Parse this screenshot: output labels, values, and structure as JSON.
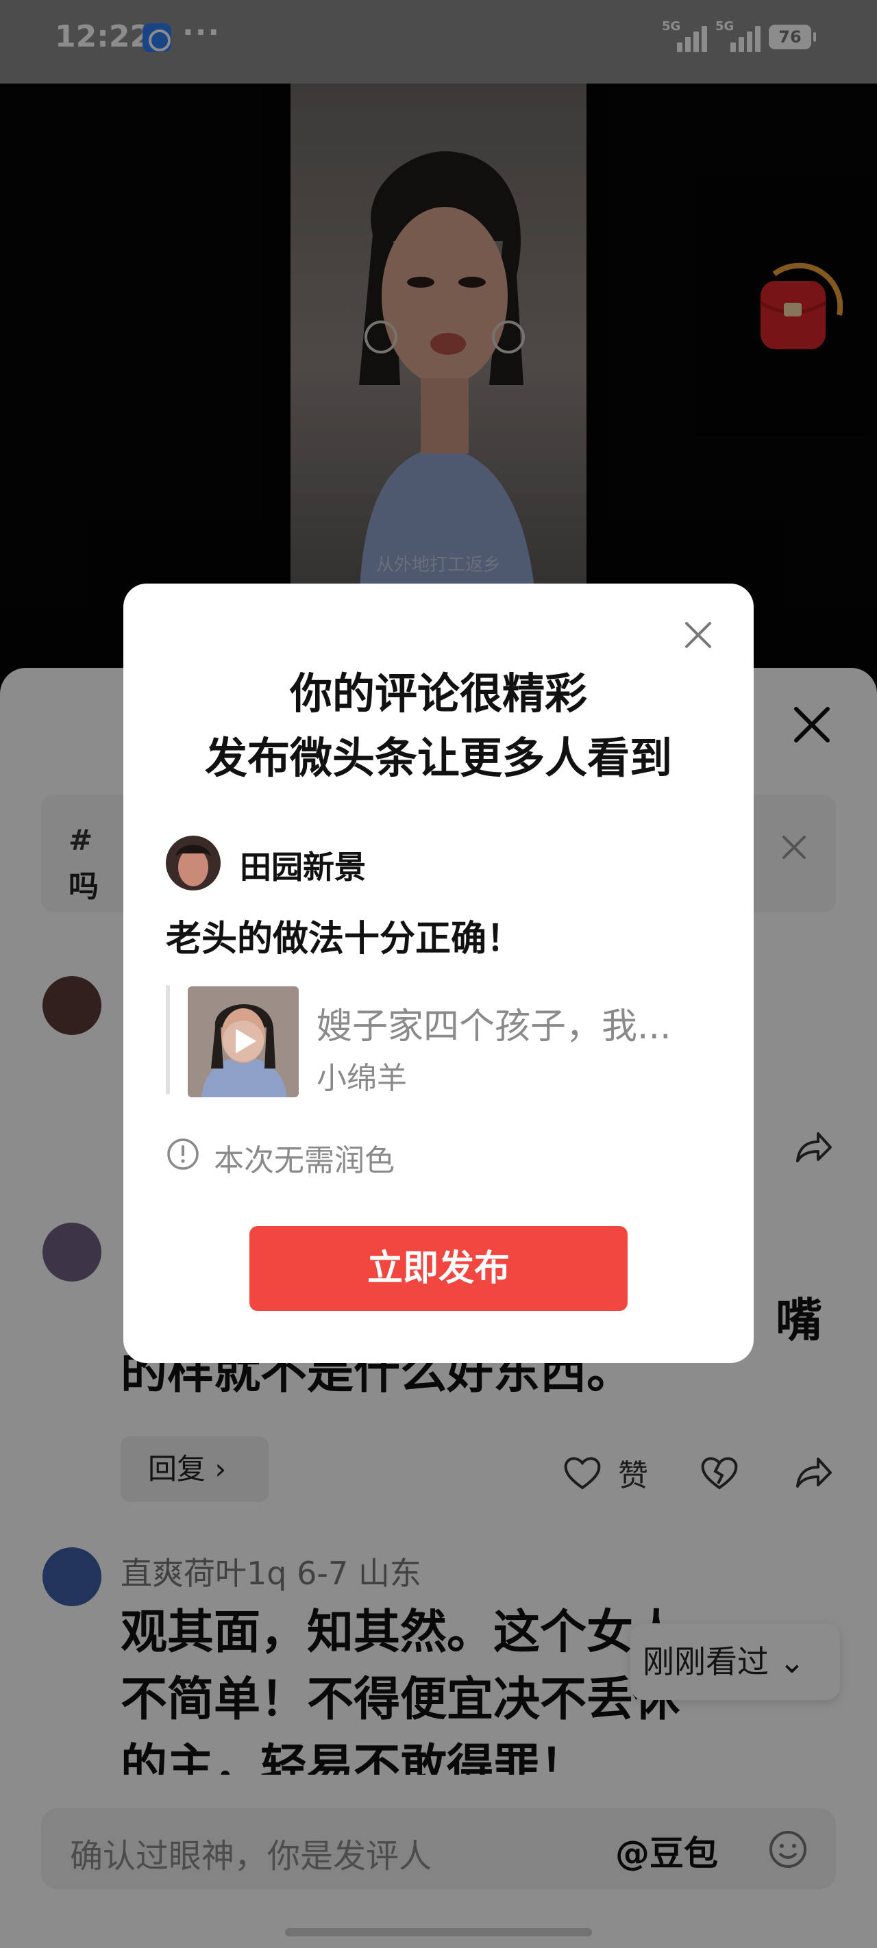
{
  "status_bar": {
    "time": "12:22",
    "dots": "···",
    "network_1": "5G",
    "network_2": "5G",
    "battery": "76"
  },
  "video": {
    "caption": "从外地打工返乡"
  },
  "comment_sheet": {
    "topic_hash": "#",
    "topic_fragment": "吗",
    "comments": [
      {
        "text_line_last_char": "嘴",
        "text": "的样就不是什么好东西。"
      },
      {
        "author": "直爽荷叶1q  6-7  山东",
        "lines": [
          "观其面，知其然。这个女人",
          "不简单！不得便宜决不丢休",
          "的主，轻易不敢得罪！"
        ]
      }
    ],
    "reply_label": "回复 ›",
    "like_label": "赞",
    "seen_pill": "刚刚看过 ⌄",
    "input_placeholder": "确认过眼神，你是发评人",
    "mention": "@豆包"
  },
  "modal": {
    "title_line1": "你的评论很精彩",
    "title_line2": "发布微头条让更多人看到",
    "username": "田园新景",
    "comment": "老头的做法十分正确！",
    "quote_title": "嫂子家四个孩子，我...",
    "quote_author": "小绵羊",
    "polish_note": "本次无需润色",
    "publish_label": "立即发布"
  }
}
